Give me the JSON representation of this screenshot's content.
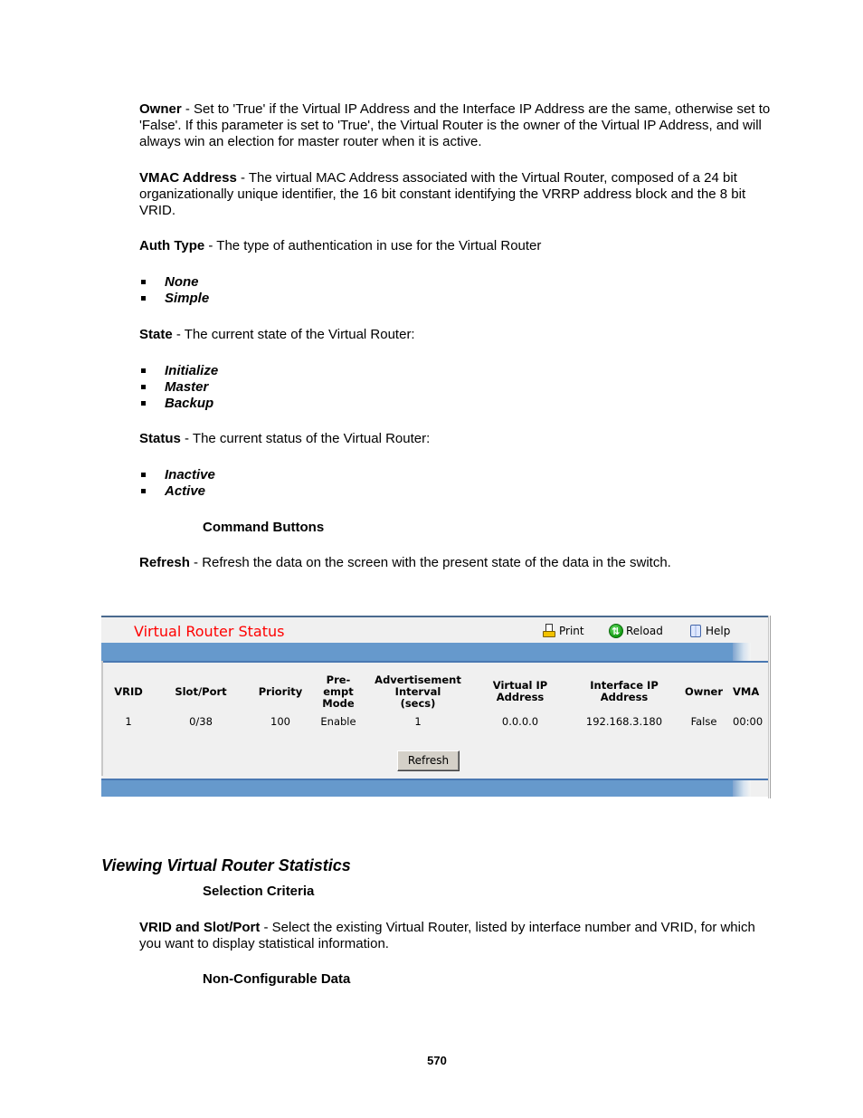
{
  "doc": {
    "owner": {
      "term": "Owner",
      "text": " - Set to 'True' if the Virtual IP Address and the Interface IP Address are the same, otherwise set to 'False'. If this parameter is set to 'True', the Virtual Router is the owner of the Virtual IP Address, and will always win an election for master router when it is active."
    },
    "vmac": {
      "term": "VMAC Address",
      "text": " - The virtual MAC Address associated with the Virtual Router, composed of a 24 bit organizationally unique identifier, the 16 bit constant identifying the VRRP address block and the 8 bit VRID."
    },
    "auth_type": {
      "term": "Auth Type",
      "text": " - The type of authentication in use for the Virtual Router",
      "options": [
        "None",
        "Simple"
      ]
    },
    "state": {
      "term": "State",
      "text": " - The current state of the Virtual Router:",
      "options": [
        "Initialize",
        "Master",
        "Backup"
      ]
    },
    "status": {
      "term": "Status",
      "text": " - The current status of the Virtual Router:",
      "options": [
        "Inactive",
        "Active"
      ]
    },
    "command_buttons_heading": "Command Buttons",
    "refresh": {
      "term": "Refresh",
      "text": " - Refresh the data on the screen with the present state of the data in the switch."
    },
    "section_title": "Viewing Virtual Router Statistics",
    "selection_criteria_heading": "Selection Criteria",
    "vrid_slot_port": {
      "term": "VRID and Slot/Port",
      "text": " - Select the existing Virtual Router, listed by interface number and VRID, for which you want to display statistical information."
    },
    "non_configurable_heading": "Non-Configurable Data",
    "page_number": "570"
  },
  "screenshot": {
    "title": "Virtual Router Status",
    "title_color": "#ff0000",
    "bar_color": "#6699cc",
    "toolbar": {
      "print_label": "Print",
      "reload_label": "Reload",
      "help_label": "Help"
    },
    "table": {
      "headers": [
        "VRID",
        "Slot/Port",
        "Priority",
        "Pre-\nempt\nMode",
        "Advertisement\nInterval\n(secs)",
        "Virtual IP\nAddress",
        "Interface IP\nAddress",
        "Owner",
        "VMA"
      ],
      "rows": [
        [
          "1",
          "0/38",
          "100",
          "Enable",
          "1",
          "0.0.0.0",
          "192.168.3.180",
          "False",
          "00:00"
        ]
      ]
    },
    "refresh_button_label": "Refresh"
  }
}
